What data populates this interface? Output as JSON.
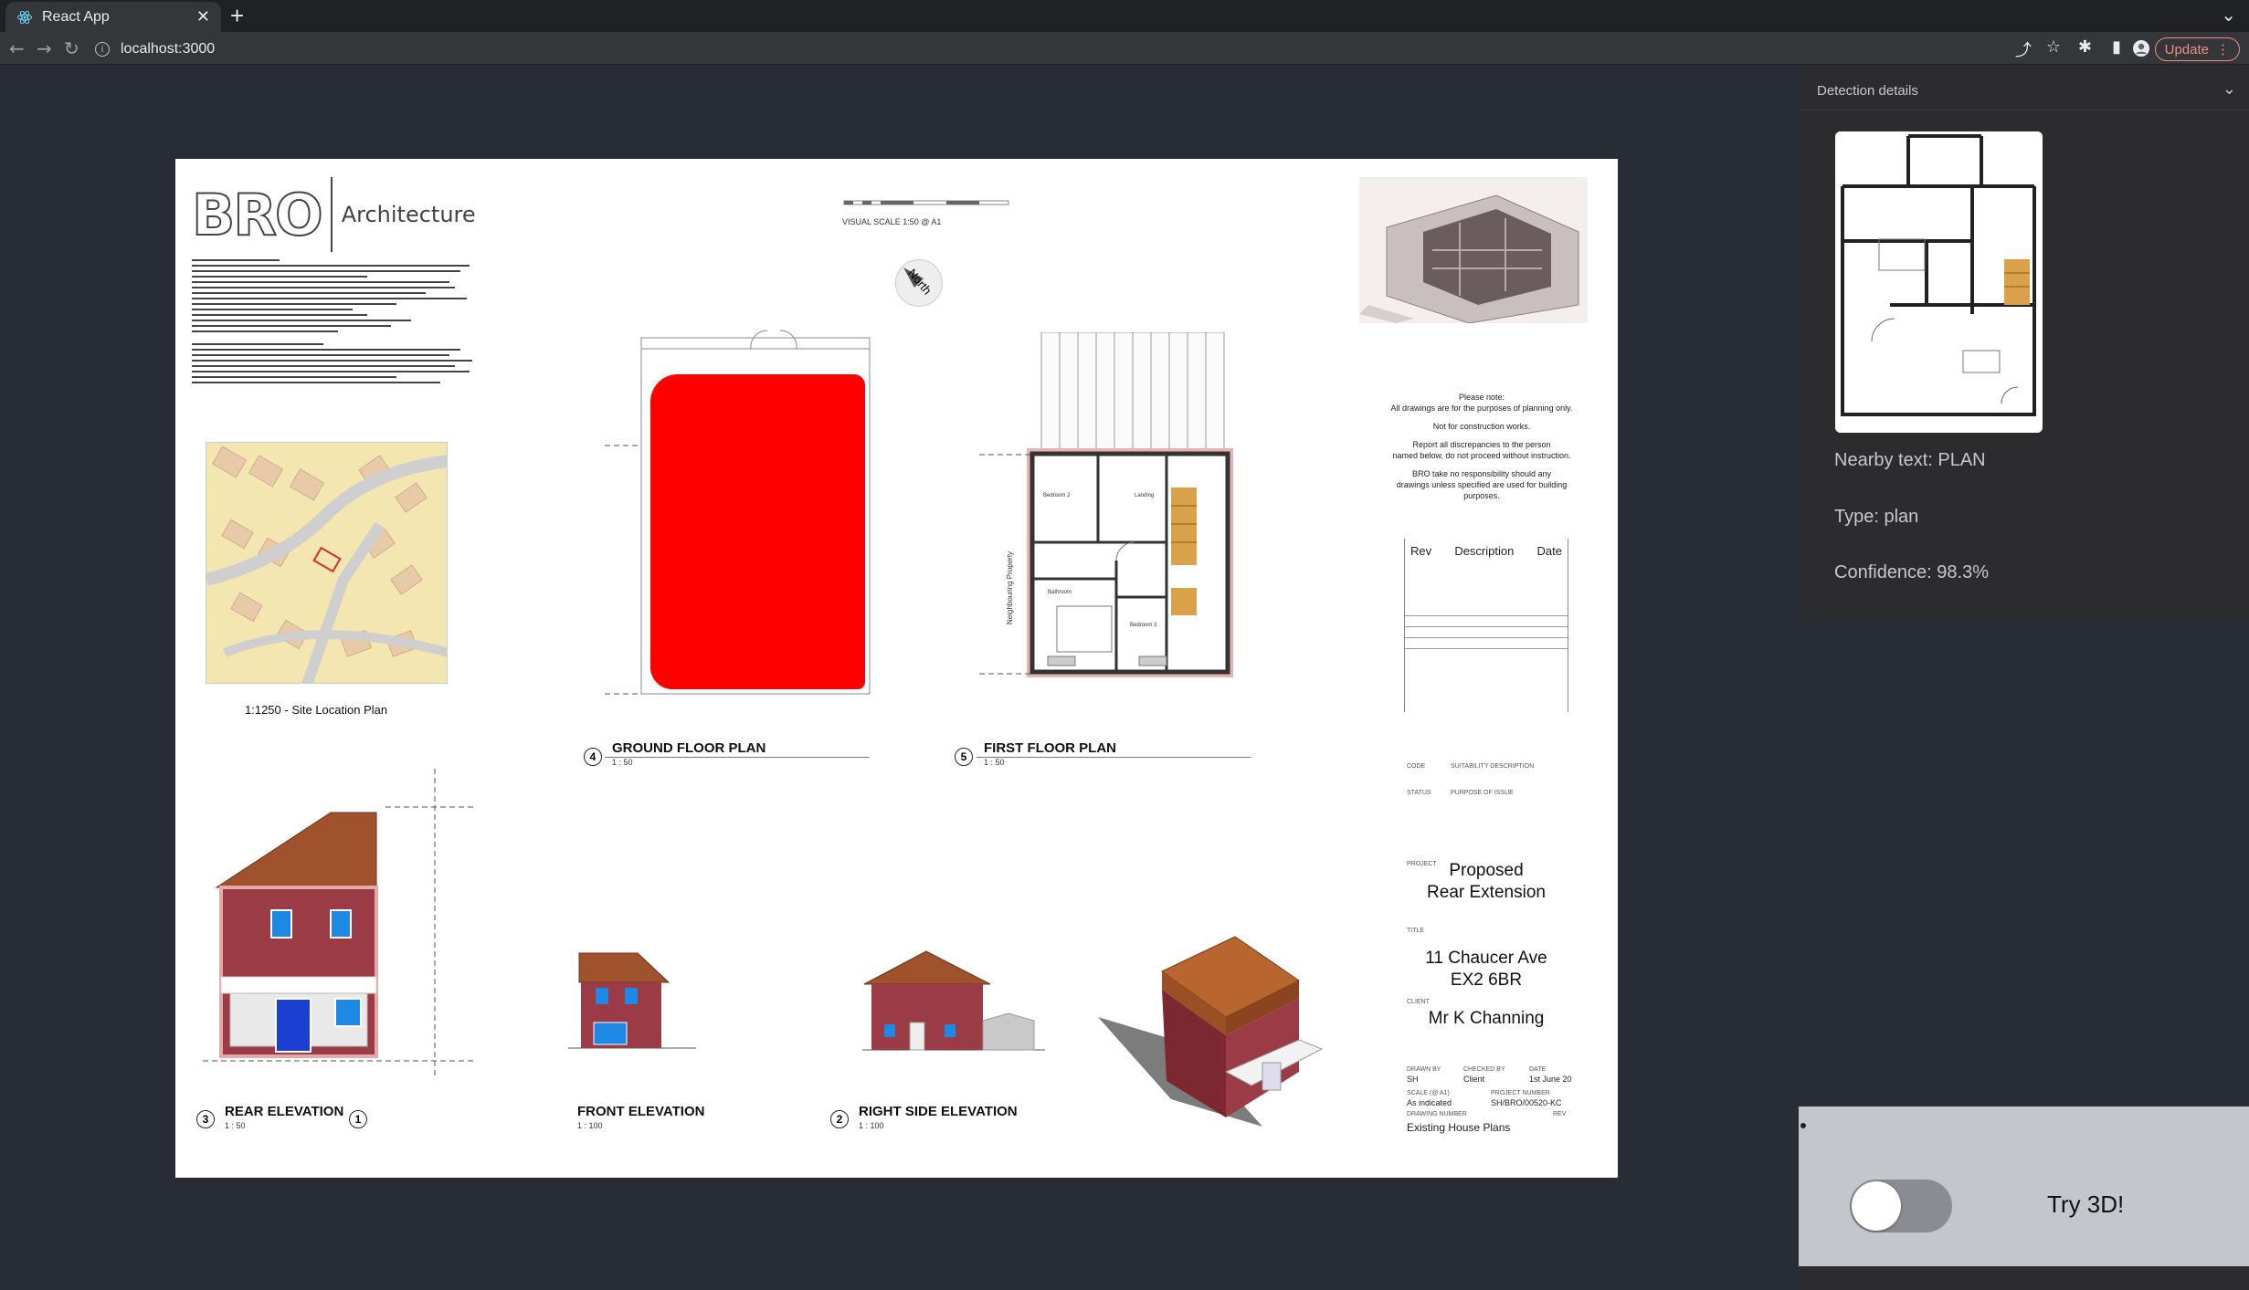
{
  "browser": {
    "tab_title": "React App",
    "tab_close": "✕",
    "new_tab": "+",
    "url": "localhost:3000",
    "update_label": "Update"
  },
  "sheet": {
    "brand_logo": "BRO",
    "brand_name": "Architecture",
    "site_plan_caption": "1:1250 - Site Location Plan",
    "visual_scale": "VISUAL SCALE 1:50 @ A1",
    "north_label": "North",
    "neighbouring_label": "Neighbouring Property",
    "views": [
      {
        "num": "4",
        "title": "GROUND FLOOR PLAN",
        "scale": "1 : 50"
      },
      {
        "num": "5",
        "title": "FIRST FLOOR PLAN",
        "scale": "1 : 50"
      },
      {
        "num": "3",
        "title": "REAR ELEVATION",
        "scale": "1 : 50"
      },
      {
        "num": "1",
        "title": "FRONT ELEVATION",
        "scale": "1 : 100"
      },
      {
        "num": "2",
        "title": "RIGHT SIDE ELEVATION",
        "scale": "1 : 100"
      }
    ],
    "rooms": {
      "bedroom2": "Bedroom 2",
      "landing": "Landing",
      "bedroom3": "Bedroom 3",
      "bathroom": "Bathroom"
    },
    "notes": [
      "Please note:",
      "All drawings are for the purposes of planning only.",
      "Not for construction works.",
      "Report all discrepancies to the person",
      "named below, do not proceed without instruction.",
      "BRO take no responsibility should any",
      "drawings unless specified are used for building purposes."
    ],
    "rev_table": {
      "rev": "Rev",
      "description": "Description",
      "date": "Date"
    },
    "title_block": {
      "code_label": "CODE",
      "suitability_label": "SUITABILITY DESCRIPTION",
      "status_label": "STATUS",
      "purpose_label": "PURPOSE OF ISSUE",
      "project_label": "PROJECT",
      "project_line1": "Proposed",
      "project_line2": "Rear Extension",
      "title_label": "TITLE",
      "address_line1": "11 Chaucer Ave",
      "address_line2": "EX2 6BR",
      "client_label": "CLIENT",
      "client": "Mr K Channing",
      "drawn_by_label": "DRAWN BY",
      "drawn_by": "SH",
      "checked_by_label": "CHECKED BY",
      "checked_by": "Client",
      "date_label": "DATE",
      "date": "1st June 20",
      "scale_label": "SCALE (@ A1)",
      "scale": "As indicated",
      "project_number_label": "PROJECT NUMBER",
      "project_number": "SH/BRO/00520-KC",
      "drawing_number_label": "DRAWING NUMBER",
      "rev_label": "REV",
      "drawing_name": "Existing House Plans"
    }
  },
  "panel": {
    "title": "Detection details",
    "nearby_text": "Nearby text: PLAN",
    "type": "Type: plan",
    "confidence": "Confidence: 98.3%"
  },
  "bottom": {
    "try3d_label": "Try 3D!",
    "toggle_on": false
  },
  "colors": {
    "page_bg": "#282c34",
    "panel_bg": "#2c2c2e",
    "bottom_bg": "#c4c6cc",
    "redaction": "#ff0000",
    "roof": "#a0522d",
    "brick": "#9b3b45",
    "window": "#1e88e5"
  }
}
